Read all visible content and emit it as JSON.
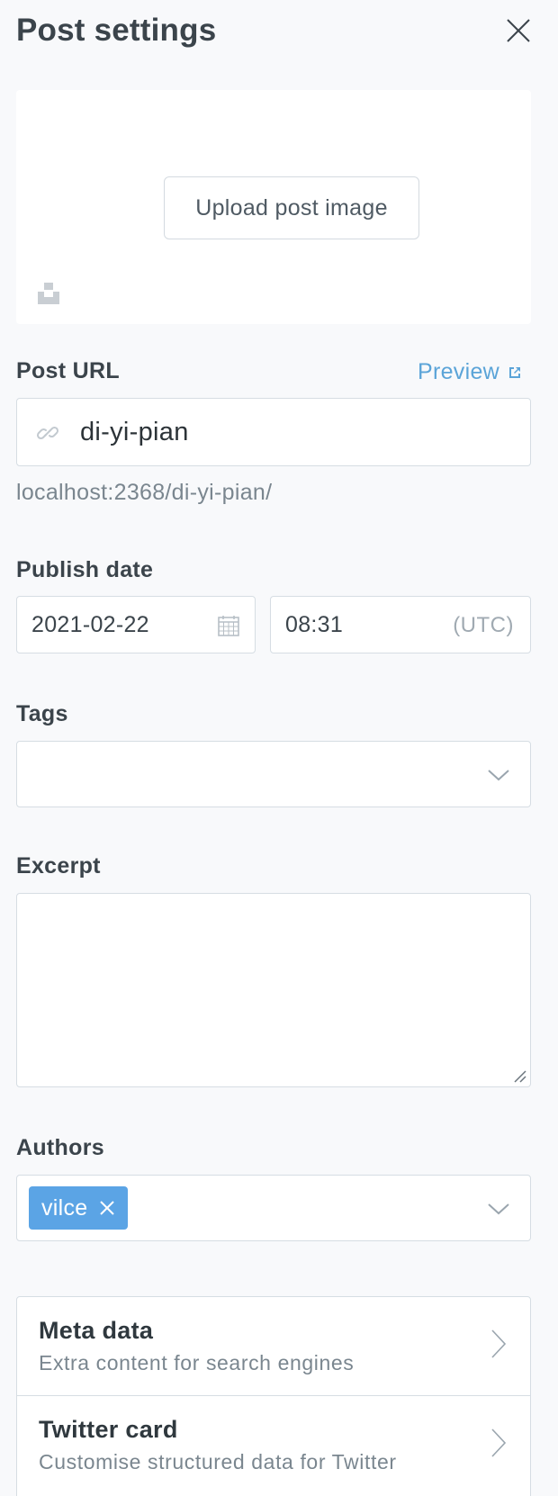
{
  "header": {
    "title": "Post settings"
  },
  "image": {
    "upload_label": "Upload post image"
  },
  "post_url": {
    "label": "Post URL",
    "preview_label": "Preview",
    "value": "di-yi-pian",
    "hint": "localhost:2368/di-yi-pian/"
  },
  "publish_date": {
    "label": "Publish date",
    "date_value": "2021-02-22",
    "time_value": "08:31",
    "timezone": "(UTC)"
  },
  "tags": {
    "label": "Tags"
  },
  "excerpt": {
    "label": "Excerpt",
    "value": ""
  },
  "authors": {
    "label": "Authors",
    "selected": [
      "vilce"
    ]
  },
  "nav": [
    {
      "title": "Meta data",
      "subtitle": "Extra content for search engines"
    },
    {
      "title": "Twitter card",
      "subtitle": "Customise structured data for Twitter"
    }
  ],
  "colors": {
    "accent": "#5ba4e5",
    "link": "#5ba4d8",
    "border": "#d6dde3",
    "background": "#f8f9fb"
  },
  "icons": [
    "close-icon",
    "unsplash-icon",
    "external-link-icon",
    "link-icon",
    "calendar-icon",
    "chevron-down-icon",
    "remove-icon",
    "chevron-right-icon"
  ]
}
